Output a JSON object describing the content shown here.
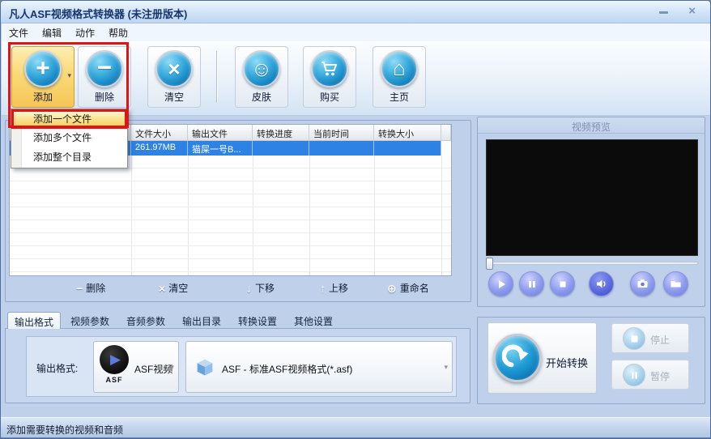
{
  "window": {
    "title": "凡人ASF视频格式转换器  (未注册版本)",
    "close_glyph": "×"
  },
  "menu_bar": {
    "items": [
      "文件",
      "编辑",
      "动作",
      "帮助"
    ]
  },
  "toolbar": {
    "add_dropdown_arrow": "▾",
    "buttons": [
      {
        "label": "添加",
        "glyph": "+"
      },
      {
        "label": "删除",
        "glyph": "−"
      },
      {
        "label": "清空",
        "glyph": "×"
      },
      {
        "label": "皮肤",
        "glyph": "☺"
      },
      {
        "label": "购买"
      },
      {
        "label": "主页",
        "glyph": "⌂"
      }
    ]
  },
  "add_menu": {
    "items": [
      "添加一个文件",
      "添加多个文件",
      "添加整个目录"
    ]
  },
  "file_table": {
    "headers": [
      "",
      "文件大小",
      "输出文件",
      "转换进度",
      "当前时间",
      "转换大小"
    ],
    "rows": [
      {
        "cells": [
          "",
          "261.97MB",
          "猫屎一号B...",
          "",
          "",
          ""
        ]
      }
    ]
  },
  "table_actions": {
    "items": [
      {
        "label": "删除",
        "glyph": "−"
      },
      {
        "label": "清空",
        "glyph": "×"
      },
      {
        "label": "下移",
        "glyph": "↓"
      },
      {
        "label": "上移",
        "glyph": "↑"
      },
      {
        "label": "重命名",
        "glyph": "⊕"
      }
    ]
  },
  "tabs": {
    "items": [
      "输出格式",
      "视频参数",
      "音频参数",
      "输出目录",
      "转换设置",
      "其他设置"
    ],
    "active": "输出格式"
  },
  "output_format": {
    "label": "输出格式:",
    "format_combo": {
      "icon_play": "▶",
      "icon_text": "ASF",
      "value": "ASF视频",
      "arrow": "▾"
    },
    "profile_combo": {
      "value": "ASF - 标准ASF视频格式(*.asf)",
      "arrow": "▾"
    }
  },
  "preview": {
    "title": "视频预览"
  },
  "convert": {
    "start_label": "开始转换",
    "stop_label": "停止",
    "pause_label": "暂停"
  },
  "status_bar": {
    "text": "添加需要转换的视频和音频"
  },
  "colors": {
    "accent_icon_blue": "#1287c9",
    "selected_row_blue": "#2e82e4",
    "annotation_red": "#e01414",
    "add_button_highlight": "#fad977",
    "player_button_blue": "#8d9bee",
    "window_background": "#bfd1ea"
  }
}
